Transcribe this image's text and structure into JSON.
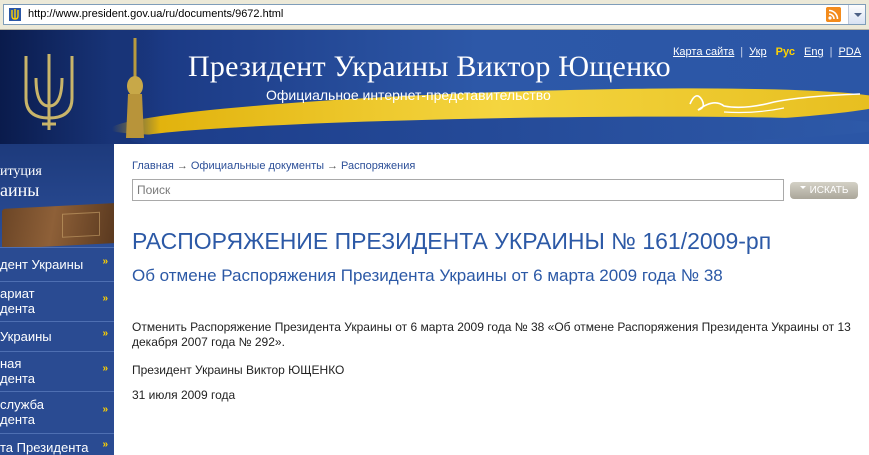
{
  "browser": {
    "url": "http://www.president.gov.ua/ru/documents/9672.html",
    "favicon_icon": "trident-icon",
    "rss_icon": "rss-feed-icon"
  },
  "header": {
    "title": "Президент Украины Виктор Ющенко",
    "subtitle": "Официальное интернет-представительство",
    "links": {
      "sitemap": "Карта сайта",
      "ukr": "Укр",
      "rus": "Рус",
      "eng": "Eng",
      "pda": "PDA"
    },
    "colors": {
      "flag_blue": "#2b56a6",
      "flag_yellow": "#f2c722",
      "active_lang": "#ffd200"
    }
  },
  "sidebar": {
    "heading_line1": "итуция",
    "heading_line2": "аины",
    "items": [
      {
        "label": "дент Украины"
      },
      {
        "label": "ариат\nдента"
      },
      {
        "label": "Украины"
      },
      {
        "label": "ная\nдента"
      },
      {
        "label": "служба\nдента"
      },
      {
        "label": "та Президента"
      }
    ],
    "arrow_glyph": "»"
  },
  "breadcrumb": {
    "items": [
      "Главная",
      "Официальные документы",
      "Распоряжения"
    ],
    "separator": "→"
  },
  "search": {
    "placeholder": "Поиск",
    "button_label": "ИСКАТЬ"
  },
  "document": {
    "title": "РАСПОРЯЖЕНИЕ ПРЕЗИДЕНТА УКРАИНЫ № 161/2009-рп",
    "subtitle": "Об отмене Распоряжения Президента Украины от 6 марта 2009 года № 38",
    "body": "Отменить Распоряжение Президента Украины от 6 марта 2009 года № 38 «Об отмене Распоряжения Президента Украины от 13 декабря 2007 года № 292».",
    "signature": "Президент Украины Виктор ЮЩЕНКО",
    "date": "31 июля 2009 года",
    "title_color": "#2c59a6"
  }
}
